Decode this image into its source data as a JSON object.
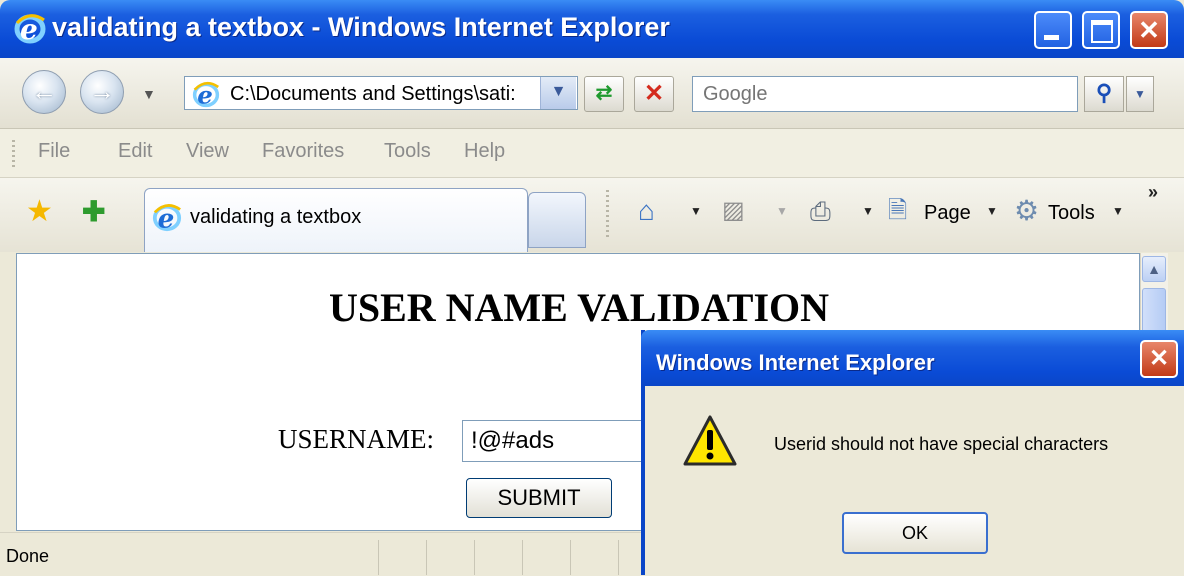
{
  "window": {
    "title": "validating a textbox - Windows Internet Explorer"
  },
  "navbar": {
    "address": "C:\\Documents and Settings\\sati:",
    "search_placeholder": "Google"
  },
  "menu": {
    "items": [
      "File",
      "Edit",
      "View",
      "Favorites",
      "Tools",
      "Help"
    ]
  },
  "tabs": {
    "active_label": "validating a textbox"
  },
  "toolbar": {
    "page_label": "Page",
    "tools_label": "Tools"
  },
  "page": {
    "heading": "USER NAME VALIDATION",
    "username_label": "USERNAME:",
    "username_value": "!@#ads",
    "submit_label": "SUBMIT"
  },
  "statusbar": {
    "text": "Done"
  },
  "dialog": {
    "title": "Windows Internet Explorer",
    "message": "Userid should not have special characters",
    "ok_label": "OK"
  },
  "colors": {
    "titlebar_blue": "#0A4BD6",
    "close_red": "#C23A17",
    "chrome_beige": "#ECE9D8"
  },
  "icons": [
    "ie-logo-icon",
    "back-arrow-icon",
    "forward-arrow-icon",
    "refresh-icon",
    "stop-icon",
    "search-icon",
    "favorites-star-icon",
    "add-favorites-icon",
    "home-icon",
    "feeds-icon",
    "print-icon",
    "page-icon",
    "tools-gear-icon",
    "warning-icon"
  ]
}
